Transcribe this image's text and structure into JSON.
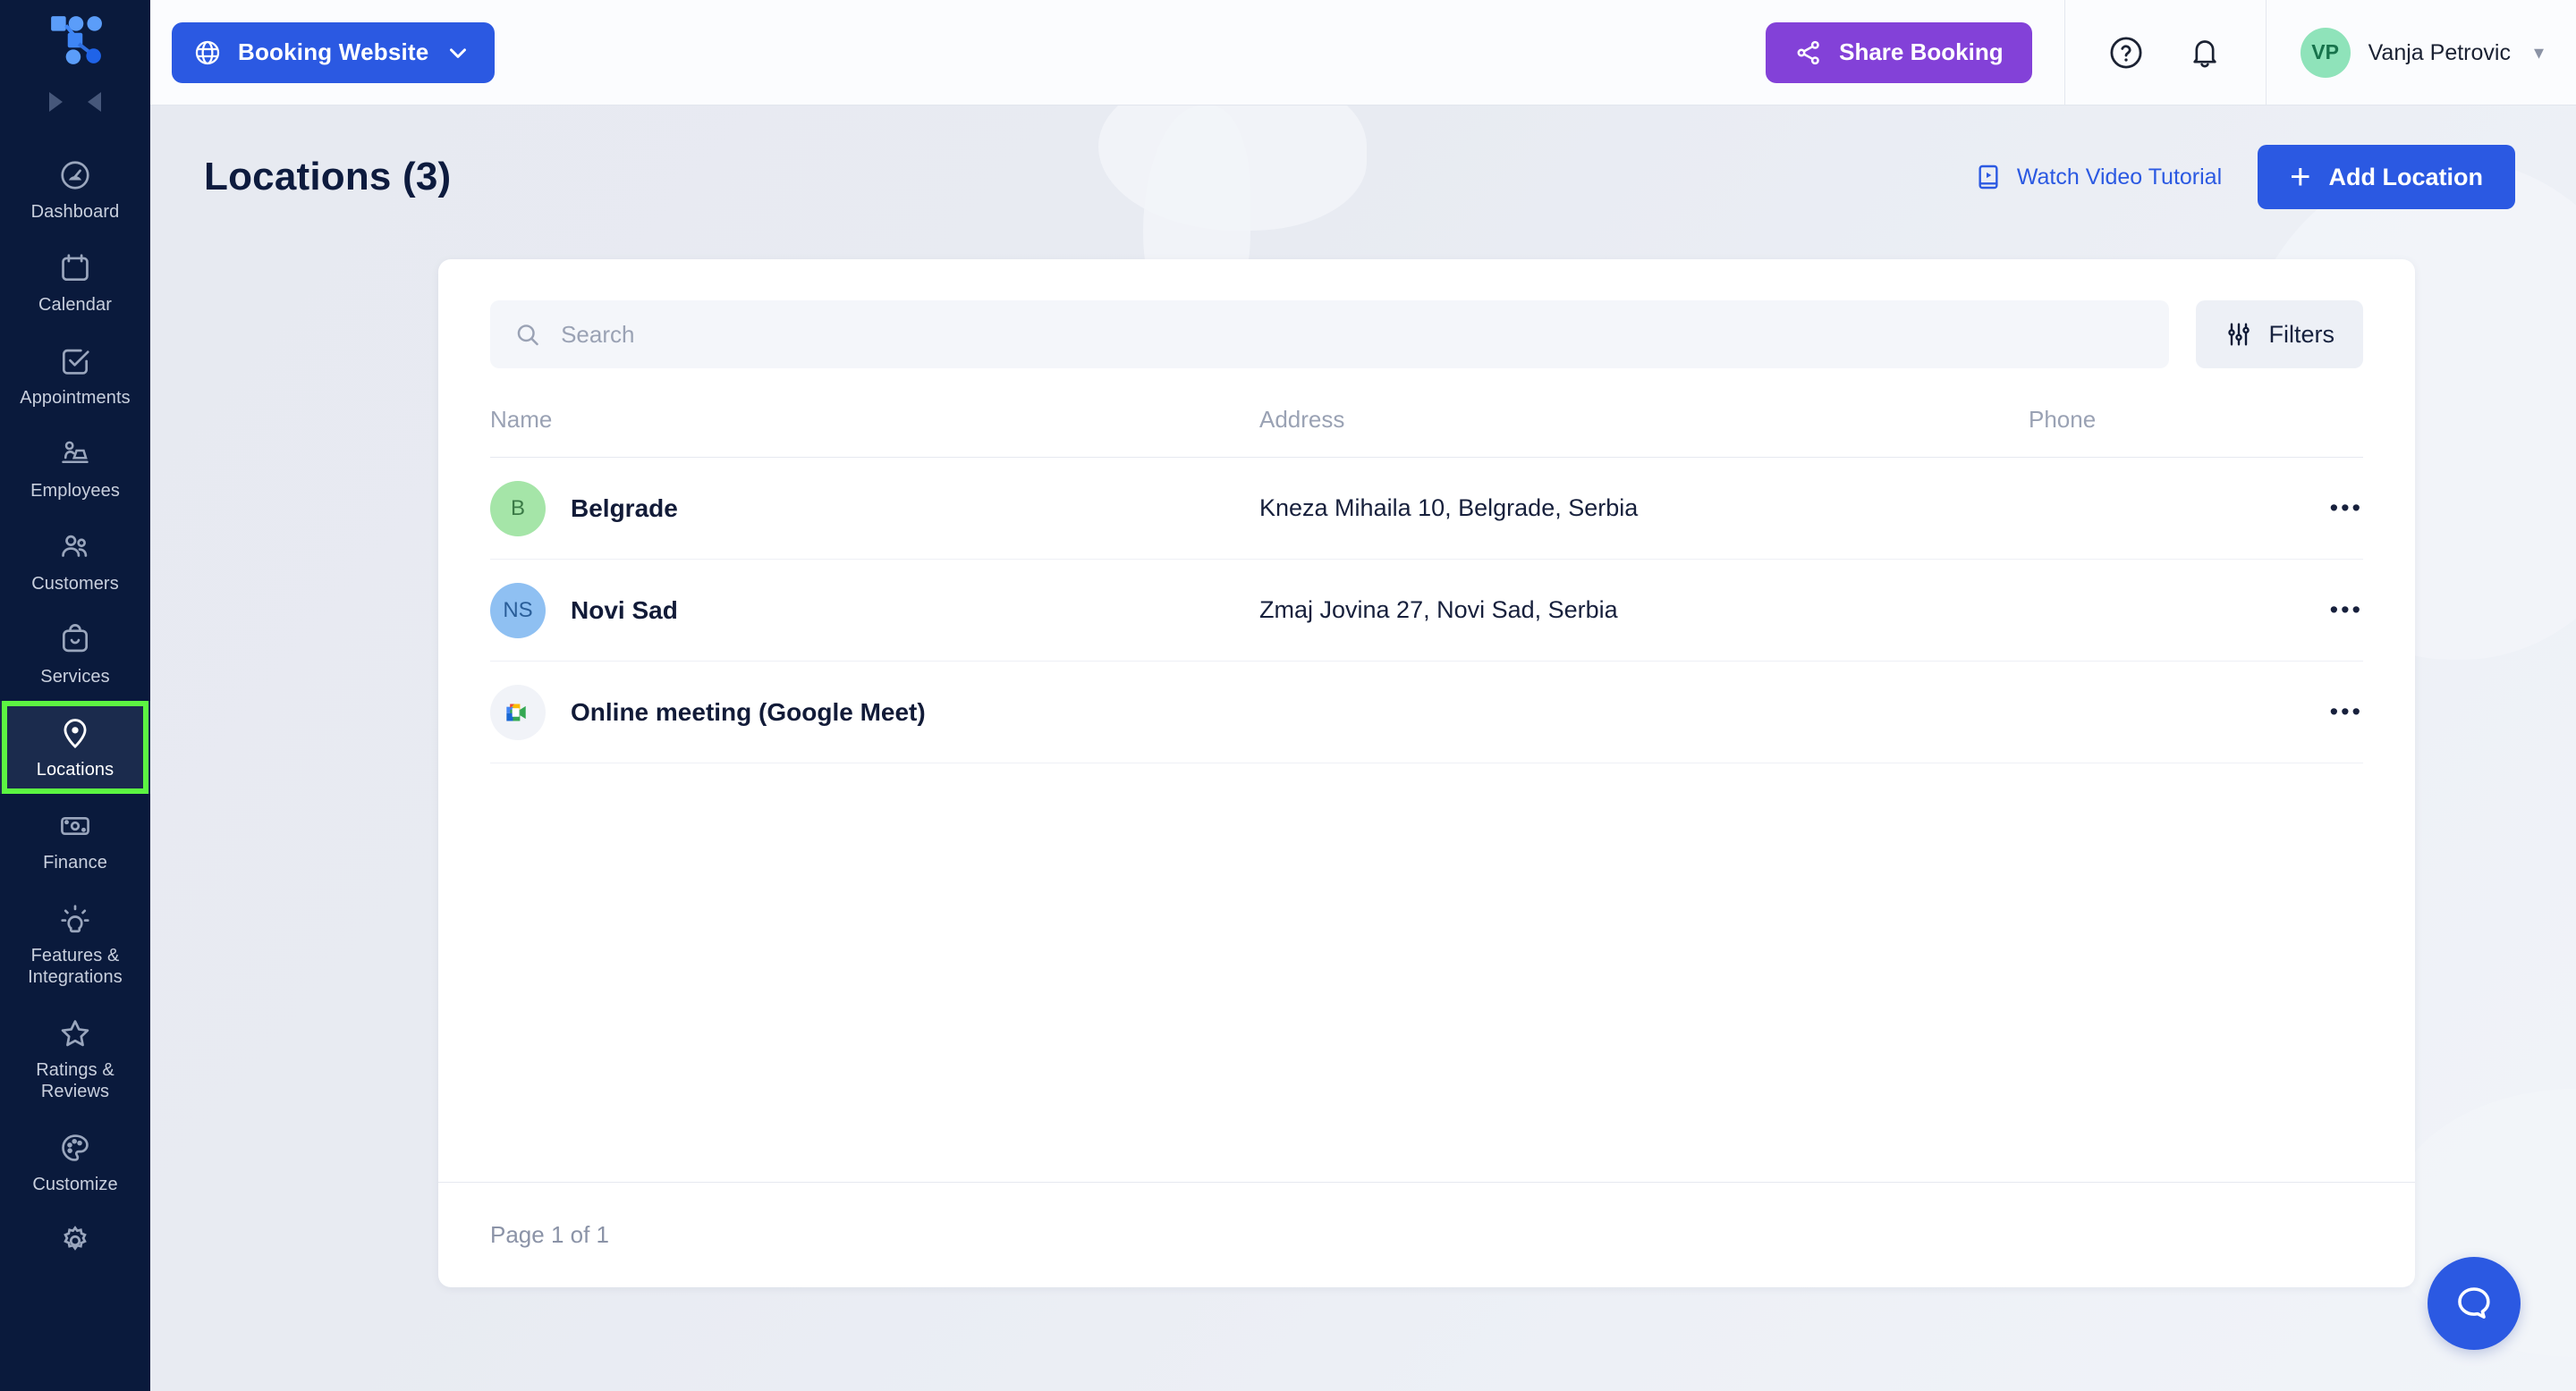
{
  "brand": {
    "logo_name": "trafft-logo",
    "sidebar_bg": "#0a1a3c",
    "accent": "#2b59e2",
    "highlight": "#5cf542"
  },
  "sidebar": {
    "collapse_forward": "collapse-forward",
    "collapse_back": "collapse-back",
    "items": [
      {
        "label": "Dashboard",
        "icon": "gauge-icon",
        "active": false
      },
      {
        "label": "Calendar",
        "icon": "calendar-icon",
        "active": false
      },
      {
        "label": "Appointments",
        "icon": "check-square-icon",
        "active": false
      },
      {
        "label": "Employees",
        "icon": "employee-desk-icon",
        "active": false
      },
      {
        "label": "Customers",
        "icon": "people-icon",
        "active": false
      },
      {
        "label": "Services",
        "icon": "bag-icon",
        "active": false
      },
      {
        "label": "Locations",
        "icon": "map-pin-icon",
        "active": true
      },
      {
        "label": "Finance",
        "icon": "banknote-icon",
        "active": false
      },
      {
        "label": "Features & Integrations",
        "icon": "lightbulb-icon",
        "active": false
      },
      {
        "label": "Ratings & Reviews",
        "icon": "star-icon",
        "active": false
      },
      {
        "label": "Customize",
        "icon": "palette-icon",
        "active": false
      },
      {
        "label": "",
        "icon": "gear-icon",
        "active": false
      }
    ]
  },
  "topbar": {
    "booking_website_label": "Booking Website",
    "booking_website_icon": "globe-icon",
    "booking_website_caret": "chevron-down-icon",
    "share_booking_label": "Share Booking",
    "share_icon": "share-nodes-icon",
    "help_icon": "question-circle-icon",
    "notifications_icon": "bell-icon",
    "user": {
      "initials": "VP",
      "name": "Vanja Petrovic",
      "caret": "chevron-down-icon"
    }
  },
  "page": {
    "title": "Locations (3)",
    "watch_video_label": "Watch Video Tutorial",
    "watch_video_icon": "video-tutorial-icon",
    "add_location_label": "Add Location",
    "add_icon": "plus-icon"
  },
  "toolbar": {
    "search_placeholder": "Search",
    "search_value": "",
    "search_icon": "search-icon",
    "filters_label": "Filters",
    "filters_icon": "sliders-icon"
  },
  "table": {
    "columns": [
      "Name",
      "Address",
      "Phone"
    ],
    "rows": [
      {
        "avatar_text": "B",
        "avatar_bg": "#a5e5a8",
        "avatar_fg": "#3a7a46",
        "avatar_type": "initials",
        "name": "Belgrade",
        "address": "Kneza Mihaila 10, Belgrade, Serbia",
        "phone": "",
        "actions": "•••"
      },
      {
        "avatar_text": "NS",
        "avatar_bg": "#8fc0f2",
        "avatar_fg": "#2a5e99",
        "avatar_type": "initials",
        "name": "Novi Sad",
        "address": "Zmaj Jovina 27, Novi Sad, Serbia",
        "phone": "",
        "actions": "•••"
      },
      {
        "avatar_text": "",
        "avatar_bg": "#f1f3f8",
        "avatar_fg": "#1b2444",
        "avatar_type": "google-meet-icon",
        "name": "Online meeting (Google Meet)",
        "address": "",
        "phone": "",
        "actions": "•••"
      }
    ]
  },
  "footer": {
    "page_info": "Page 1 of 1"
  },
  "help_widget": {
    "icon": "chat-bubble-icon"
  }
}
